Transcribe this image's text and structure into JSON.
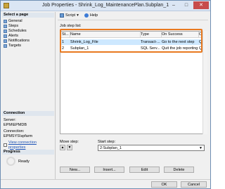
{
  "window": {
    "title": "Job Properties - Shrink_Log_MaintenancePlan.Subplan_1"
  },
  "left_pane": {
    "select_page_header": "Select a page",
    "pages": [
      "General",
      "Steps",
      "Schedules",
      "Alerts",
      "Notifications",
      "Targets"
    ],
    "connection_header": "Connection",
    "server_label": "Server:",
    "server_value": "EPM\\EPMDB",
    "connection_label": "Connection:",
    "connection_value": "EPMSYS\\spfarm",
    "view_link": "View connection properties",
    "progress_header": "Progress",
    "progress_status": "Ready"
  },
  "toolbar": {
    "script_label": "Script",
    "help_label": "Help"
  },
  "job_step_list": {
    "label": "Job step list:",
    "columns": [
      "St...",
      "Name",
      "Type",
      "On Success",
      "On..."
    ],
    "rows": [
      {
        "step": "1",
        "name": "Shrink_Log_File",
        "type": "Transact-...",
        "on_success": "Go to the next step",
        "on_failure": "Qu..."
      },
      {
        "step": "2",
        "name": "Subplan_1",
        "type": "SQL Serv...",
        "on_success": "Quit the job reporting s...",
        "on_failure": "Qu..."
      }
    ]
  },
  "move_step_label": "Move step:",
  "start_step_label": "Start step:",
  "start_step_value": "2:Subplan_1",
  "buttons": {
    "new": "New...",
    "insert": "Insert...",
    "edit": "Edit",
    "delete": "Delete",
    "ok": "OK",
    "cancel": "Cancel"
  },
  "colors": {
    "selection": "#cde8ff",
    "highlight_border": "#e8791f",
    "title_bar": "#dbe6f4"
  }
}
